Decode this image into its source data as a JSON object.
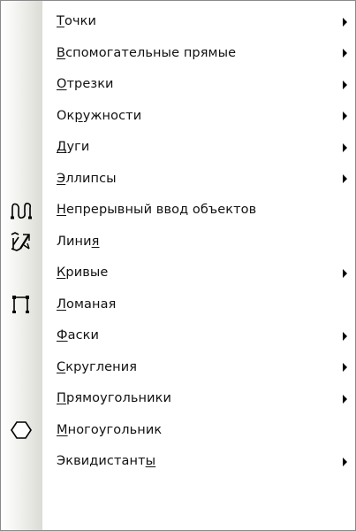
{
  "menu": {
    "items": [
      {
        "pre": "",
        "ul": "Т",
        "post": "очки",
        "submenu": true,
        "icon": null
      },
      {
        "pre": "",
        "ul": "В",
        "post": "спомогательные прямые",
        "submenu": true,
        "icon": null
      },
      {
        "pre": "",
        "ul": "О",
        "post": "трезки",
        "submenu": true,
        "icon": null
      },
      {
        "pre": "Ок",
        "ul": "р",
        "post": "ужности",
        "submenu": true,
        "icon": null
      },
      {
        "pre": "",
        "ul": "Д",
        "post": "уги",
        "submenu": true,
        "icon": null
      },
      {
        "pre": "",
        "ul": "Э",
        "post": "ллипсы",
        "submenu": true,
        "icon": null
      },
      {
        "pre": "",
        "ul": "Н",
        "post": "епрерывный ввод объектов",
        "submenu": false,
        "icon": "continuous-input-icon"
      },
      {
        "pre": "Лини",
        "ul": "я",
        "post": "",
        "submenu": false,
        "icon": "line-icon"
      },
      {
        "pre": "",
        "ul": "К",
        "post": "ривые",
        "submenu": true,
        "icon": null
      },
      {
        "pre": "",
        "ul": "Л",
        "post": "оманая",
        "submenu": false,
        "icon": "polyline-icon"
      },
      {
        "pre": "",
        "ul": "Ф",
        "post": "аски",
        "submenu": true,
        "icon": null
      },
      {
        "pre": "",
        "ul": "С",
        "post": "кругления",
        "submenu": true,
        "icon": null
      },
      {
        "pre": "",
        "ul": "П",
        "post": "рямоугольники",
        "submenu": true,
        "icon": null
      },
      {
        "pre": "",
        "ul": "М",
        "post": "ногоугольник",
        "submenu": false,
        "icon": "polygon-icon"
      },
      {
        "pre": "Эквидистант",
        "ul": "ы",
        "post": "",
        "submenu": true,
        "icon": null
      }
    ]
  }
}
